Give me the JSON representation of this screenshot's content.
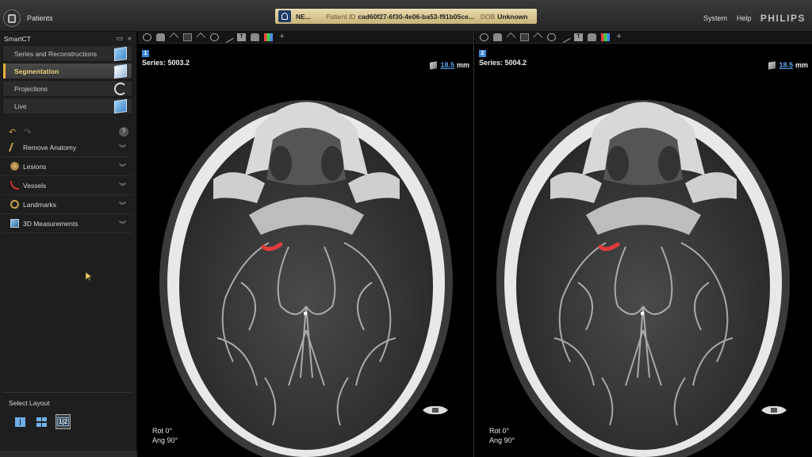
{
  "topbar": {
    "patients_label": "Patients",
    "patient_name": "NE...",
    "patient_id_label": "Patient ID",
    "patient_id_value": "cad60f27-6f30-4e06-ba53-f91b05ce...",
    "dob_label": "DOB",
    "dob_value": "Unknown",
    "menu": [
      "System",
      "Help"
    ],
    "brand": "PHILIPS"
  },
  "left_panel": {
    "title": "SmartCT",
    "workflow": [
      {
        "label": "Series and Reconstructions",
        "icon": "cube-icon",
        "active": false
      },
      {
        "label": "Segmentation",
        "icon": "cube-icon",
        "active": true
      },
      {
        "label": "Projections",
        "icon": "rotate-icon",
        "active": false
      },
      {
        "label": "Live",
        "icon": "live-cube-icon",
        "active": false
      }
    ],
    "tools": [
      {
        "label": "Remove Anatomy",
        "icon": "remove-anatomy-icon"
      },
      {
        "label": "Lesions",
        "icon": "lesion-icon"
      },
      {
        "label": "Vessels",
        "icon": "vessel-icon"
      },
      {
        "label": "Landmarks",
        "icon": "landmark-icon"
      },
      {
        "label": "3D Measurements",
        "icon": "measure-3d-icon"
      }
    ],
    "help_glyph": "?",
    "layout_title": "Select Layout",
    "layout_selected_label": "1|2"
  },
  "viewports": [
    {
      "number": "1",
      "series": "Series: 5003.2",
      "thickness": "18.5",
      "unit": "mm",
      "rot": "Rot  0°",
      "ang": "Ang  90°"
    },
    {
      "number": "2",
      "series": "Series: 5004.2",
      "thickness": "18.5",
      "unit": "mm",
      "rot": "Rot  0°",
      "ang": "Ang  90°"
    }
  ],
  "colors": {
    "accent": "#e2b43c",
    "thickness_link": "#5aa8f0",
    "banner": "#d9c78f",
    "segment_highlight": "#e33c3c"
  }
}
